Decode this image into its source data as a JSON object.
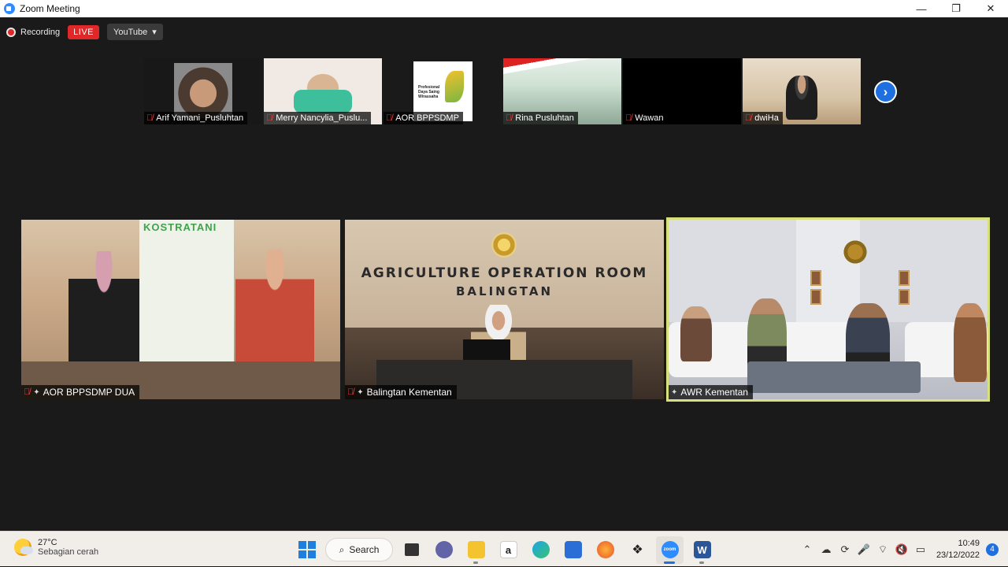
{
  "window": {
    "title": "Zoom Meeting",
    "minimize": "—",
    "maximize": "❐",
    "close": "✕"
  },
  "recording": {
    "label": "Recording",
    "live_badge": "LIVE",
    "stream_target": "YouTube",
    "stream_caret": "▾"
  },
  "gallery": {
    "participants": [
      {
        "name": "Arif Yamani_Pusluhtan",
        "muted": true
      },
      {
        "name": "Merry Nancylia_Puslu...",
        "muted": true
      },
      {
        "name": "AOR BPPSDMP",
        "muted": true
      },
      {
        "name": "Rina Pusluhtan",
        "muted": true
      },
      {
        "name": "Wawan",
        "muted": true
      },
      {
        "name": "dwiHa",
        "muted": true
      }
    ],
    "next_arrow": "›"
  },
  "thumb_text": {
    "logo_text": "Profesional Daya Saing Wirausaha"
  },
  "tiles": [
    {
      "name": "AOR BPPSDMP DUA",
      "muted": true,
      "pinned": true,
      "banner": "KOSTRATANI"
    },
    {
      "name": "Balingtan Kementan",
      "muted": true,
      "pinned": true,
      "sign_line1": "AGRICULTURE OPERATION ROOM",
      "sign_line2": "BALINGTAN"
    },
    {
      "name": "AWR Kementan",
      "muted": false,
      "pinned": true,
      "active_speaker": true
    }
  ],
  "icons": {
    "mic_off": "🎙",
    "pin": "📌"
  },
  "taskbar": {
    "weather_temp": "27°C",
    "weather_desc": "Sebagian cerah",
    "search_label": "Search",
    "apps": [
      "start",
      "search",
      "task-view",
      "teams-chat",
      "file-explorer",
      "amazon",
      "edge",
      "microsoft-store",
      "firefox",
      "dropbox",
      "zoom",
      "word"
    ],
    "clock_time": "10:49",
    "clock_date": "23/12/2022",
    "notification_count": "4"
  },
  "colors": {
    "accent_blue": "#1e6fe0",
    "live_red": "#e02828",
    "active_speaker_outline": "#d7e07a",
    "meeting_bg": "#1a1a1a"
  }
}
